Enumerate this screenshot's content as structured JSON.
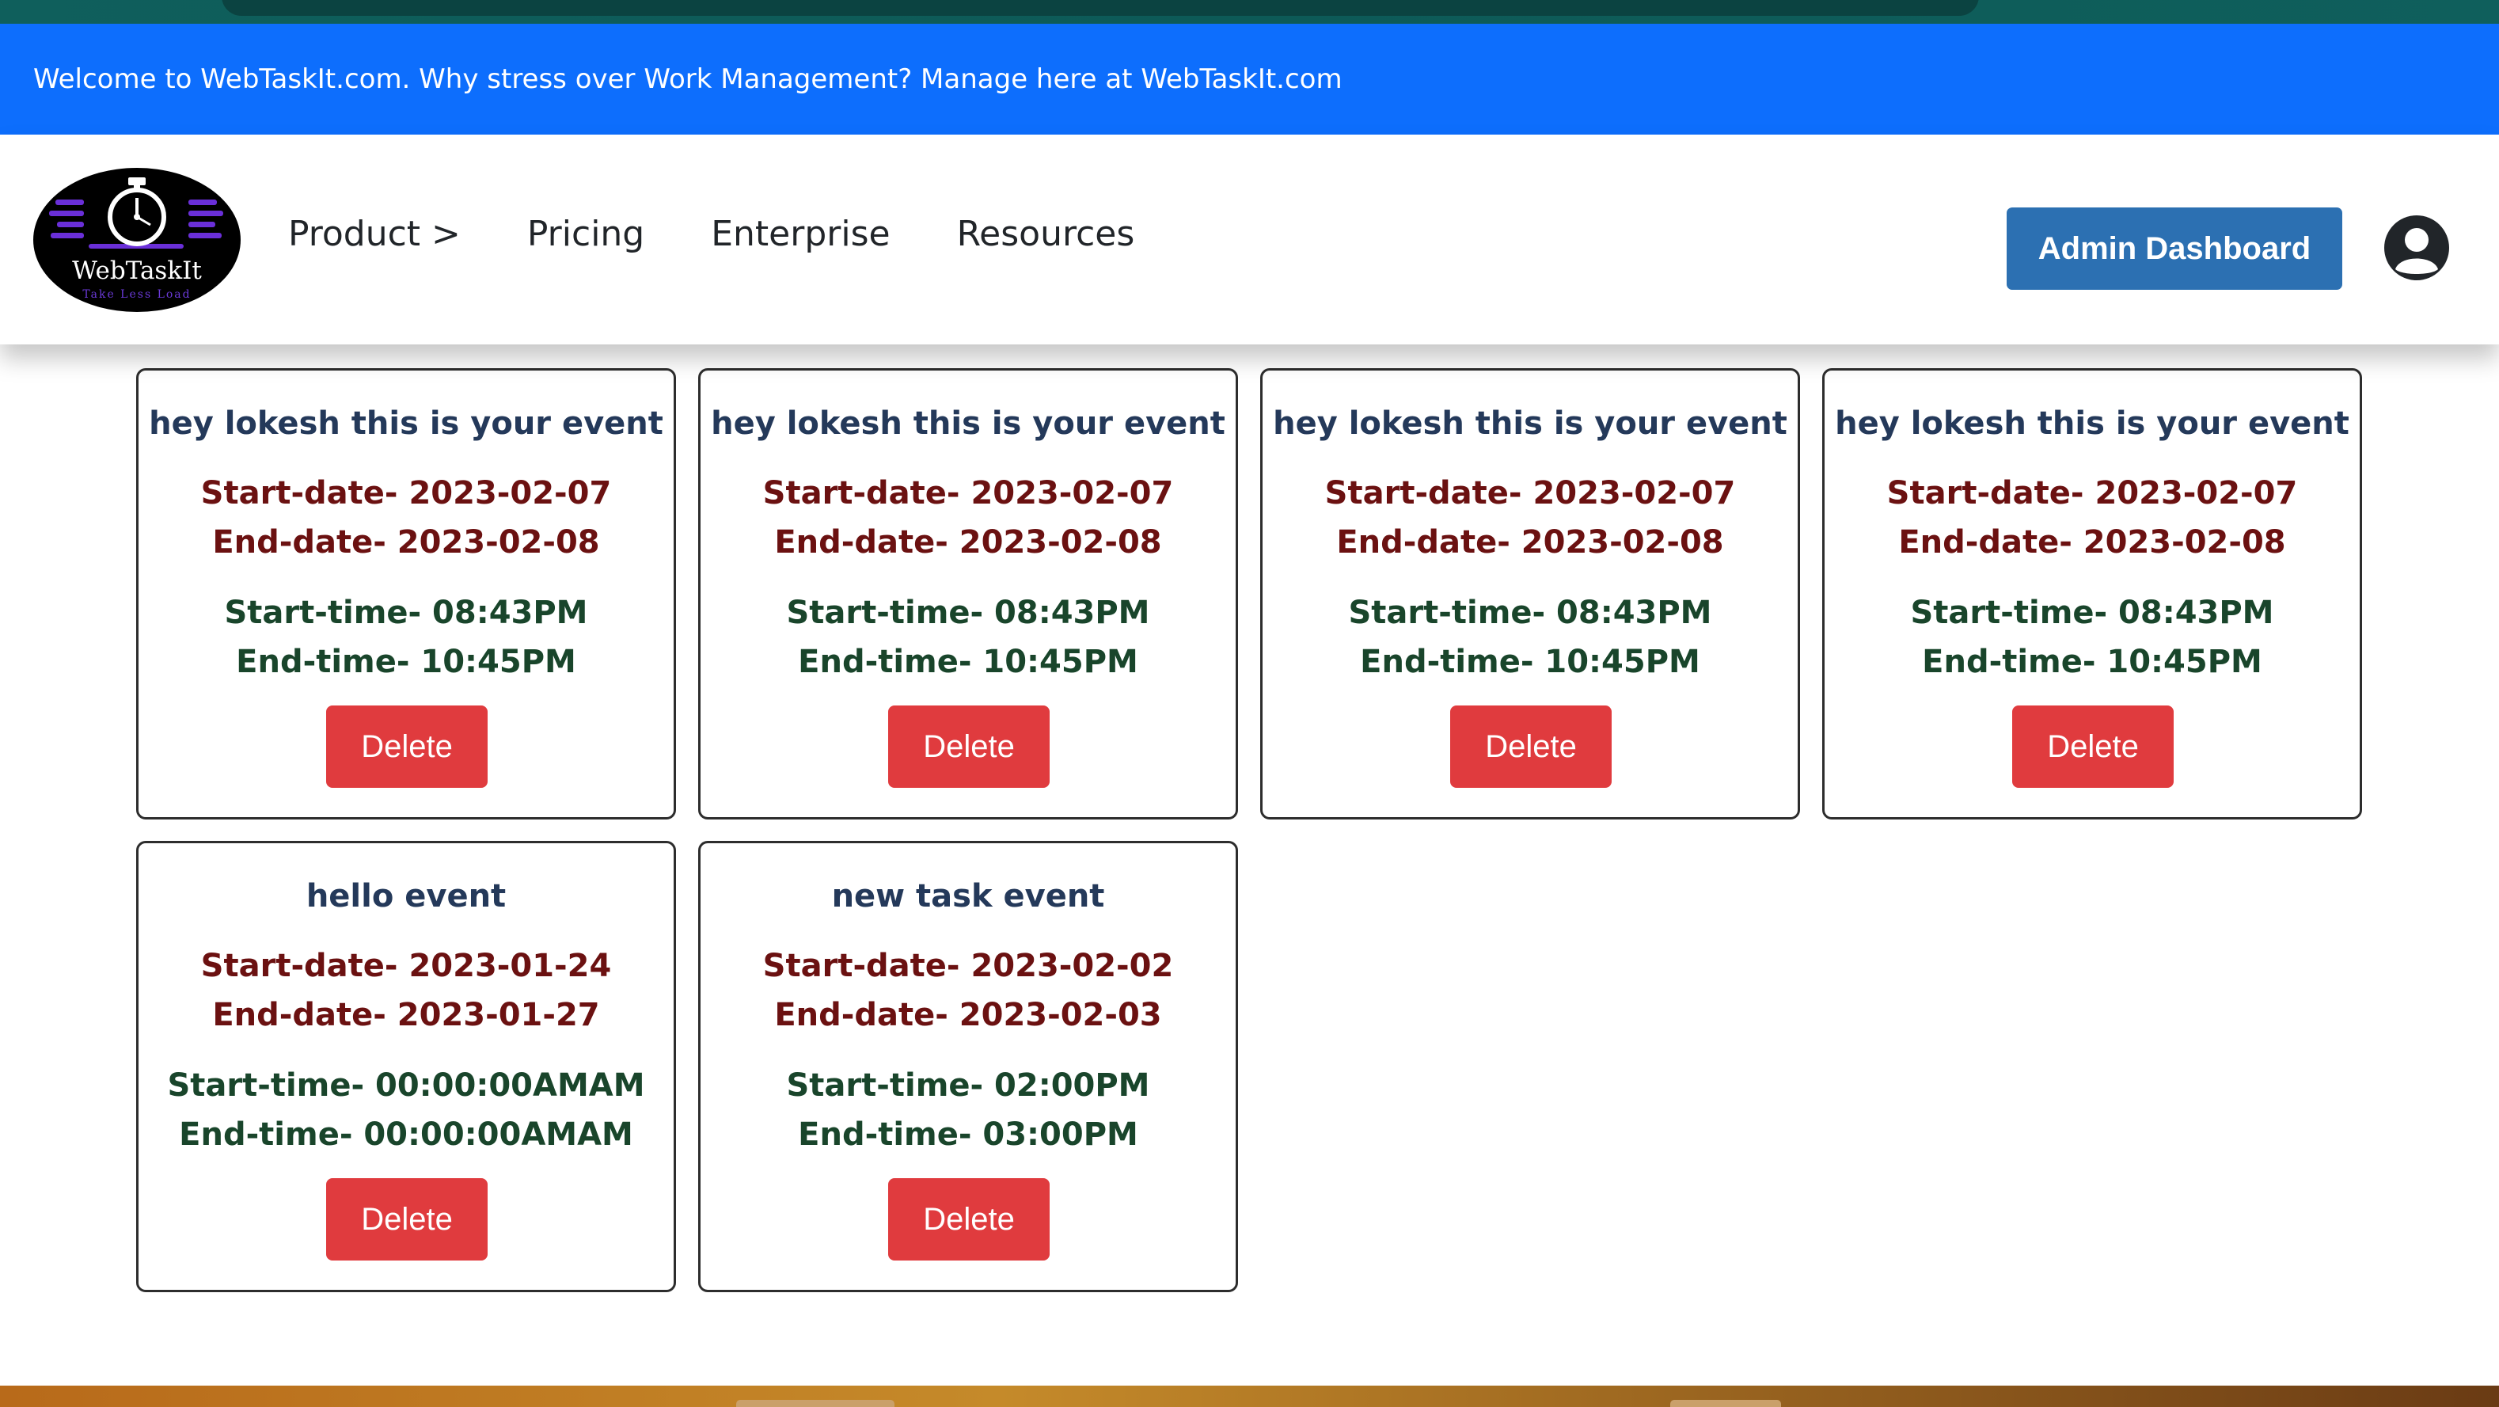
{
  "announcement": "Welcome to WebTaskIt.com. Why stress over Work Management? Manage here at WebTaskIt.com",
  "logo": {
    "name": "WebTaskIt",
    "tagline": "Take Less Load"
  },
  "nav": {
    "links": [
      "Product >",
      "Pricing",
      "Enterprise",
      "Resources"
    ],
    "admin_button": "Admin Dashboard"
  },
  "labels": {
    "start_date": "Start-date- ",
    "end_date": "End-date- ",
    "start_time": "Start-time- ",
    "end_time": "End-time- ",
    "delete": "Delete"
  },
  "events": [
    {
      "title": "hey lokesh this is your event",
      "start_date": "Start-date- 2023-02-07",
      "end_date": "End-date- 2023-02-08",
      "start_time": "Start-time- 08:43PM",
      "end_time": "End-time- 10:45PM",
      "delete": "Delete"
    },
    {
      "title": "hey lokesh this is your event",
      "start_date": "Start-date- 2023-02-07",
      "end_date": "End-date- 2023-02-08",
      "start_time": "Start-time- 08:43PM",
      "end_time": "End-time- 10:45PM",
      "delete": "Delete"
    },
    {
      "title": "hey lokesh this is your event",
      "start_date": "Start-date- 2023-02-07",
      "end_date": "End-date- 2023-02-08",
      "start_time": "Start-time- 08:43PM",
      "end_time": "End-time- 10:45PM",
      "delete": "Delete"
    },
    {
      "title": "hey lokesh this is your event",
      "start_date": "Start-date- 2023-02-07",
      "end_date": "End-date- 2023-02-08",
      "start_time": "Start-time- 08:43PM",
      "end_time": "End-time- 10:45PM",
      "delete": "Delete"
    },
    {
      "title": "hello event",
      "start_date": "Start-date- 2023-01-24",
      "end_date": "End-date- 2023-01-27",
      "start_time": "Start-time- 00:00:00AMAM",
      "end_time": "End-time- 00:00:00AMAM",
      "delete": "Delete"
    },
    {
      "title": "new task event",
      "start_date": "Start-date- 2023-02-02",
      "end_date": "End-date- 2023-02-03",
      "start_time": "Start-time- 02:00PM",
      "end_time": "End-time- 03:00PM",
      "delete": "Delete"
    }
  ],
  "icons": {
    "logo": "stopwatch-logo-icon",
    "user": "user-circle-icon"
  },
  "colors": {
    "announcement_bg": "#0d6efd",
    "admin_button_bg": "#2c70b2",
    "delete_button_bg": "#e03b3e",
    "title_color": "#24395a",
    "date_color": "#6b1111",
    "time_color": "#19452b"
  }
}
